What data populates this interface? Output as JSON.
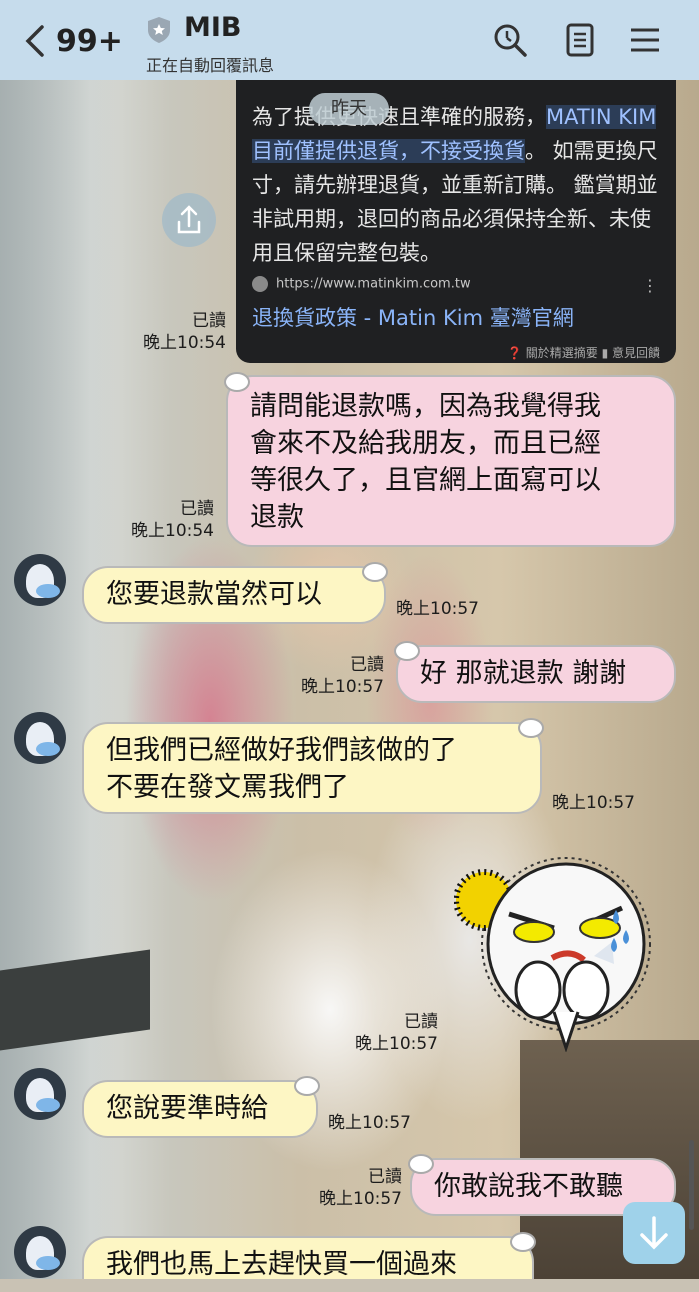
{
  "header": {
    "unread_count": "99+",
    "title": "MIB",
    "subtitle": "正在自動回覆訊息",
    "accent_color": "#c6dcec",
    "icons": [
      "back-icon",
      "search-icon",
      "notes-icon",
      "menu-icon"
    ]
  },
  "date_chip": "昨天",
  "shared_card": {
    "text_before": "為了提供更快速且準確的服務，",
    "highlight": "MATIN KIM 目前僅提供退貨，不接受換貨",
    "text_after": "。 如需更換尺寸，請先辦理退貨，並重新訂購。 鑑賞期並非試用期，退回的商品必須保持全新、未使用且保留完整包裝。",
    "url": "https://www.matinkim.com.tw",
    "link_title": "退換貨政策 - Matin Kim 臺灣官網",
    "footer": "❓ 關於精選摘要   ▮ 意見回饋",
    "read_label": "已讀",
    "time": "晚上10:54"
  },
  "messages": [
    {
      "side": "out",
      "lines": [
        "請問能退款嗎，因為我覺得我",
        "會來不及給我朋友，而且已經",
        "等很久了，且官網上面寫可以",
        "退款"
      ],
      "read": "已讀",
      "time": "晚上10:54"
    },
    {
      "side": "in",
      "lines": [
        "您要退款當然可以"
      ],
      "time": "晚上10:57"
    },
    {
      "side": "out",
      "lines": [
        "好 那就退款 謝謝"
      ],
      "read": "已讀",
      "time": "晚上10:57"
    },
    {
      "side": "in",
      "lines": [
        "但我們已經做好我們該做的了",
        "不要在發文罵我們了"
      ],
      "time": "晚上10:57"
    },
    {
      "side": "out",
      "sticker": "angry-moon-sticker",
      "read": "已讀",
      "time": "晚上10:57"
    },
    {
      "side": "in",
      "lines": [
        "您說要準時給"
      ],
      "time": "晚上10:57"
    },
    {
      "side": "out",
      "lines": [
        "你敢說我不敢聽"
      ],
      "read": "已讀",
      "time": "晚上10:57"
    },
    {
      "side": "in",
      "lines": [
        "我們也馬上去趕快買一個過來"
      ]
    }
  ],
  "colors": {
    "incoming_bubble": "#fdf6c4",
    "outgoing_bubble": "#f7d3df",
    "scroll_button": "#9fd2ea"
  }
}
